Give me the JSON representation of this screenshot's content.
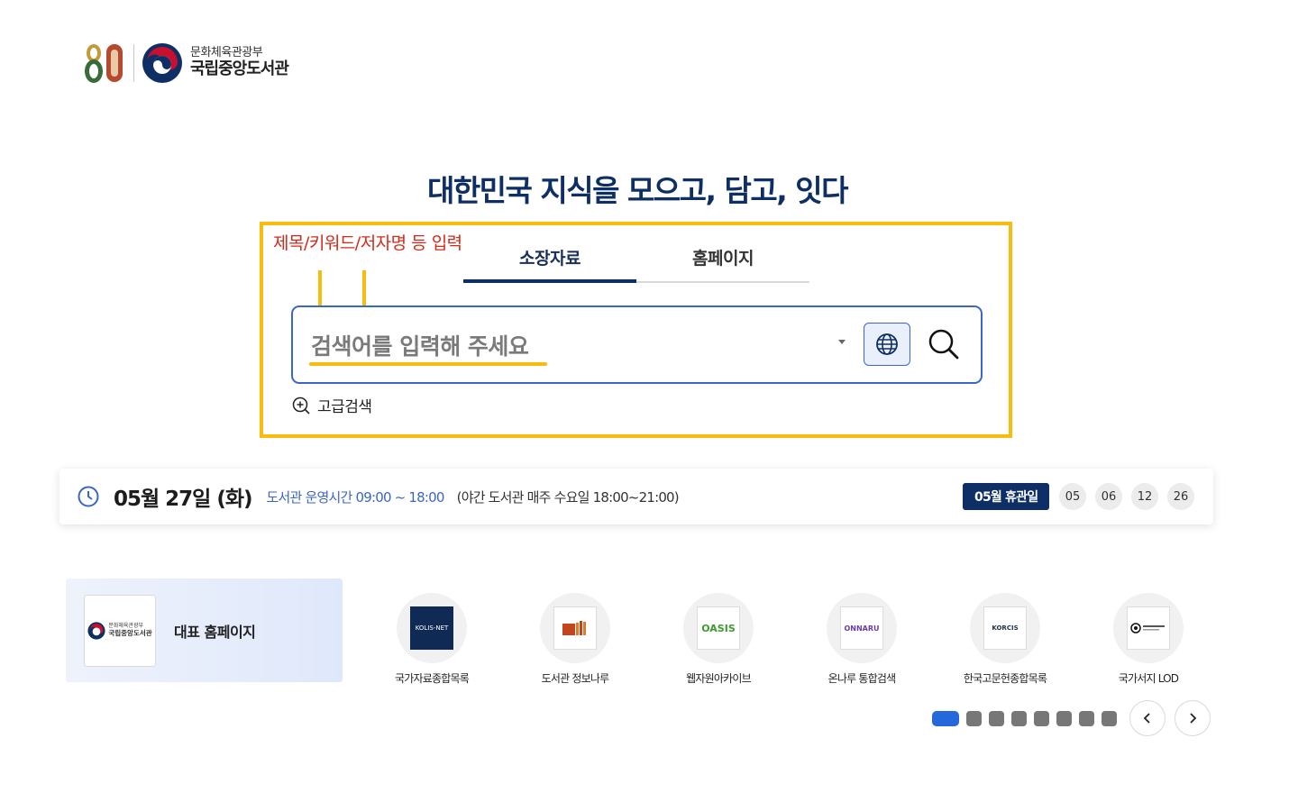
{
  "header": {
    "anniversary": "80",
    "ministry": "문화체육관광부",
    "library": "국립중앙도서관"
  },
  "headline": "대한민국 지식을  모으고, 담고, 잇다",
  "annotation": {
    "text": "제목/키워드/저자명 등 입력",
    "color": "#d42a1a",
    "box_color": "#f6bd0f"
  },
  "search": {
    "tabs": [
      {
        "label": "소장자료",
        "active": true
      },
      {
        "label": "홈페이지",
        "active": false
      }
    ],
    "placeholder": "검색어를 입력해 주세요",
    "advanced_label": "고급검색"
  },
  "info": {
    "date": "05월 27일 (화)",
    "hours": "도서관 운영시간 09:00 ~ 18:00",
    "night": "(야간 도서관 매주 수요일 18:00~21:00)",
    "closed_label": "05월 휴관일",
    "closed_days": [
      "05",
      "06",
      "12",
      "26"
    ]
  },
  "links": {
    "main_home": {
      "label": "대표 홈페이지",
      "ministry": "문화체육관광부",
      "library": "국립중앙도서관"
    },
    "items": [
      {
        "label": "국가자료종합목록",
        "icon": "kolis-net-logo",
        "logo_text": "KOLIS-NET"
      },
      {
        "label": "도서관 정보나루",
        "icon": "books-logo",
        "logo_text": ""
      },
      {
        "label": "웹자원아카이브",
        "icon": "oasis-logo",
        "logo_text": "OASIS"
      },
      {
        "label": "온나루 통합검색",
        "icon": "onnaru-logo",
        "logo_text": "ONNARU"
      },
      {
        "label": "한국고문헌종합목록",
        "icon": "korcis-logo",
        "logo_text": "KORCIS"
      },
      {
        "label": "국가서지 LOD",
        "icon": "lod-logo",
        "logo_text": ""
      }
    ]
  },
  "pagination": {
    "total_pages": 8,
    "current_page": 1
  },
  "colors": {
    "brand_navy": "#0d2f66",
    "accent_blue": "#3b66c8",
    "active_dot": "#2468db"
  }
}
